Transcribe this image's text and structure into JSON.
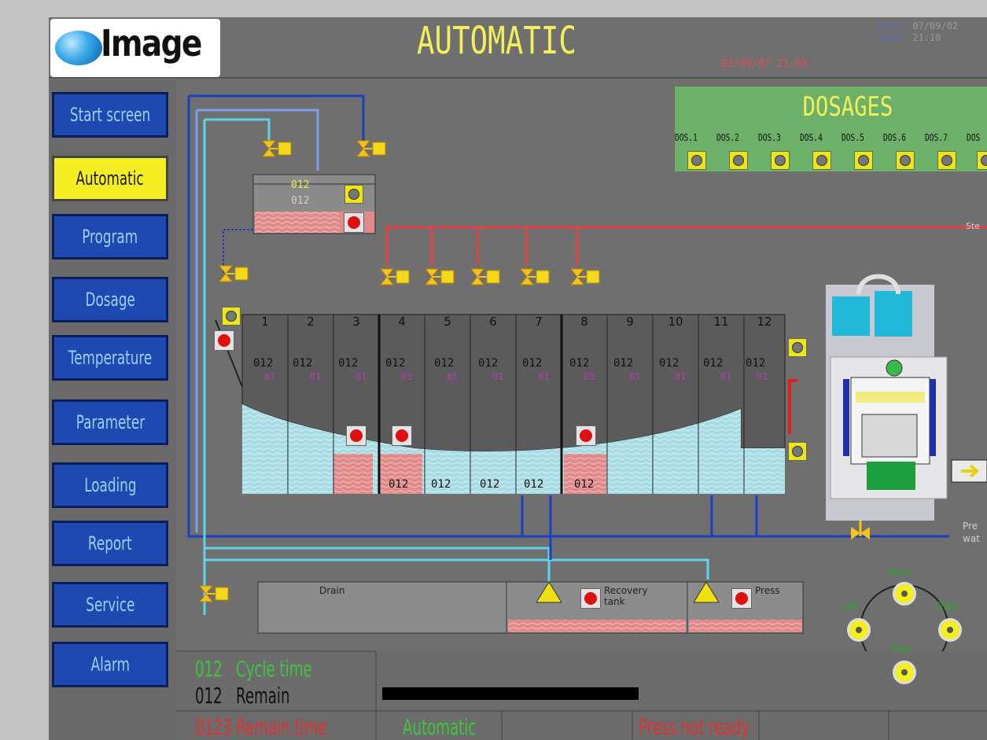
{
  "header": {
    "logo_text": "Image",
    "title": "AUTOMATIC",
    "date_label": "Date:",
    "date_value": "07/09/02",
    "time_label": "Time:",
    "time_value": "21:10",
    "alarm_timestamp": "02/09/07 21:09"
  },
  "sidebar": {
    "items": [
      {
        "label": "Start screen"
      },
      {
        "label": "Automatic"
      },
      {
        "label": "Program"
      },
      {
        "label": "Dosage"
      },
      {
        "label": "Temperature"
      },
      {
        "label": "Parameter"
      },
      {
        "label": "Loading"
      },
      {
        "label": "Report"
      },
      {
        "label": "Service"
      },
      {
        "label": "Alarm"
      }
    ],
    "active_index": 1
  },
  "dosages": {
    "title": "DOSAGES",
    "labels": [
      "DOS.1",
      "DOS.2",
      "DOS.3",
      "DOS.4",
      "DOS.5",
      "DOS.6",
      "DOS.7",
      "DOS"
    ]
  },
  "tank": {
    "value_top": "012",
    "value_bottom": "012"
  },
  "compartments": {
    "numbers": [
      "1",
      "2",
      "3",
      "4",
      "5",
      "6",
      "7",
      "8",
      "9",
      "10",
      "11",
      "12"
    ],
    "value": "012",
    "sub_value": "01"
  },
  "bottom_tanks": {
    "drain_label": "Drain",
    "recovery_label": "Recovery tank",
    "press_label": "Press"
  },
  "positions": {
    "back": "Back",
    "left": "Left",
    "right": "Right",
    "rest": "Rest"
  },
  "side_labels": {
    "steam": "Ste",
    "pressure": "Pre",
    "water": "wat"
  },
  "legend": {
    "cycle_value": "012",
    "cycle_label": "Cycle time",
    "remain_value": "012",
    "remain_label": "Remain",
    "remain_time_value": "0123",
    "remain_time_label": "Remain time"
  },
  "status": {
    "mode": "Automatic",
    "press_status": "Press not ready"
  },
  "colors": {
    "background": "#6f6f6f",
    "nav_blue": "#1f49b0",
    "active_yellow": "#f4ee22",
    "title_yellow": "#f2f05a",
    "pipe_blue": "#1e3fbf",
    "pipe_cyan": "#5fd3e8",
    "pipe_red": "#e84040",
    "dosage_green": "#6db06a"
  }
}
